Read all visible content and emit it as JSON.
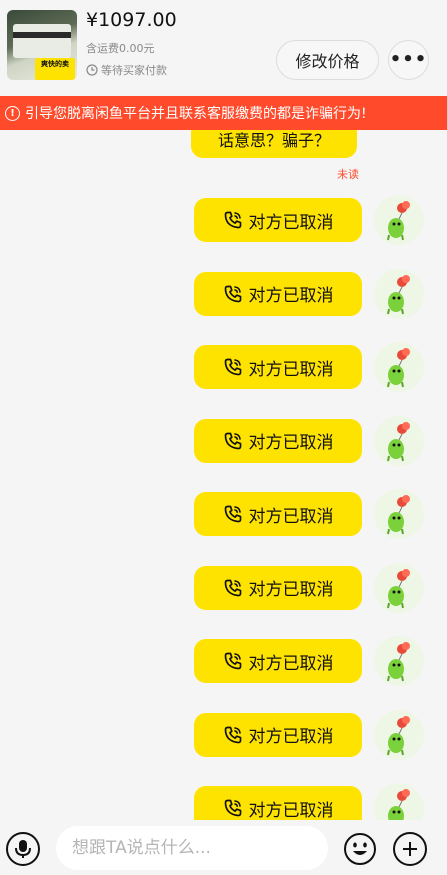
{
  "header": {
    "price": "¥1097.00",
    "shipping": "含运费0.00元",
    "status": "等待买家付款",
    "thumbnail_sticker": "爽快的卖",
    "edit_price_label": "修改价格",
    "more_label": "•••"
  },
  "warning": {
    "icon": "!",
    "text": "引导您脱离闲鱼平台并且联系客服缴费的都是诈骗行为!"
  },
  "chat": {
    "partial_message": "话意思？骗子？",
    "unread_label": "未读",
    "messages": [
      {
        "text": "对方已取消"
      },
      {
        "text": "对方已取消"
      },
      {
        "text": "对方已取消"
      },
      {
        "text": "对方已取消"
      },
      {
        "text": "对方已取消"
      },
      {
        "text": "对方已取消"
      },
      {
        "text": "对方已取消"
      },
      {
        "text": "对方已取消"
      },
      {
        "text": "对方已取消"
      }
    ]
  },
  "input": {
    "placeholder": "想跟TA说点什么..."
  },
  "colors": {
    "accent_yellow": "#ffe300",
    "warning_red": "#ff4b2b"
  }
}
